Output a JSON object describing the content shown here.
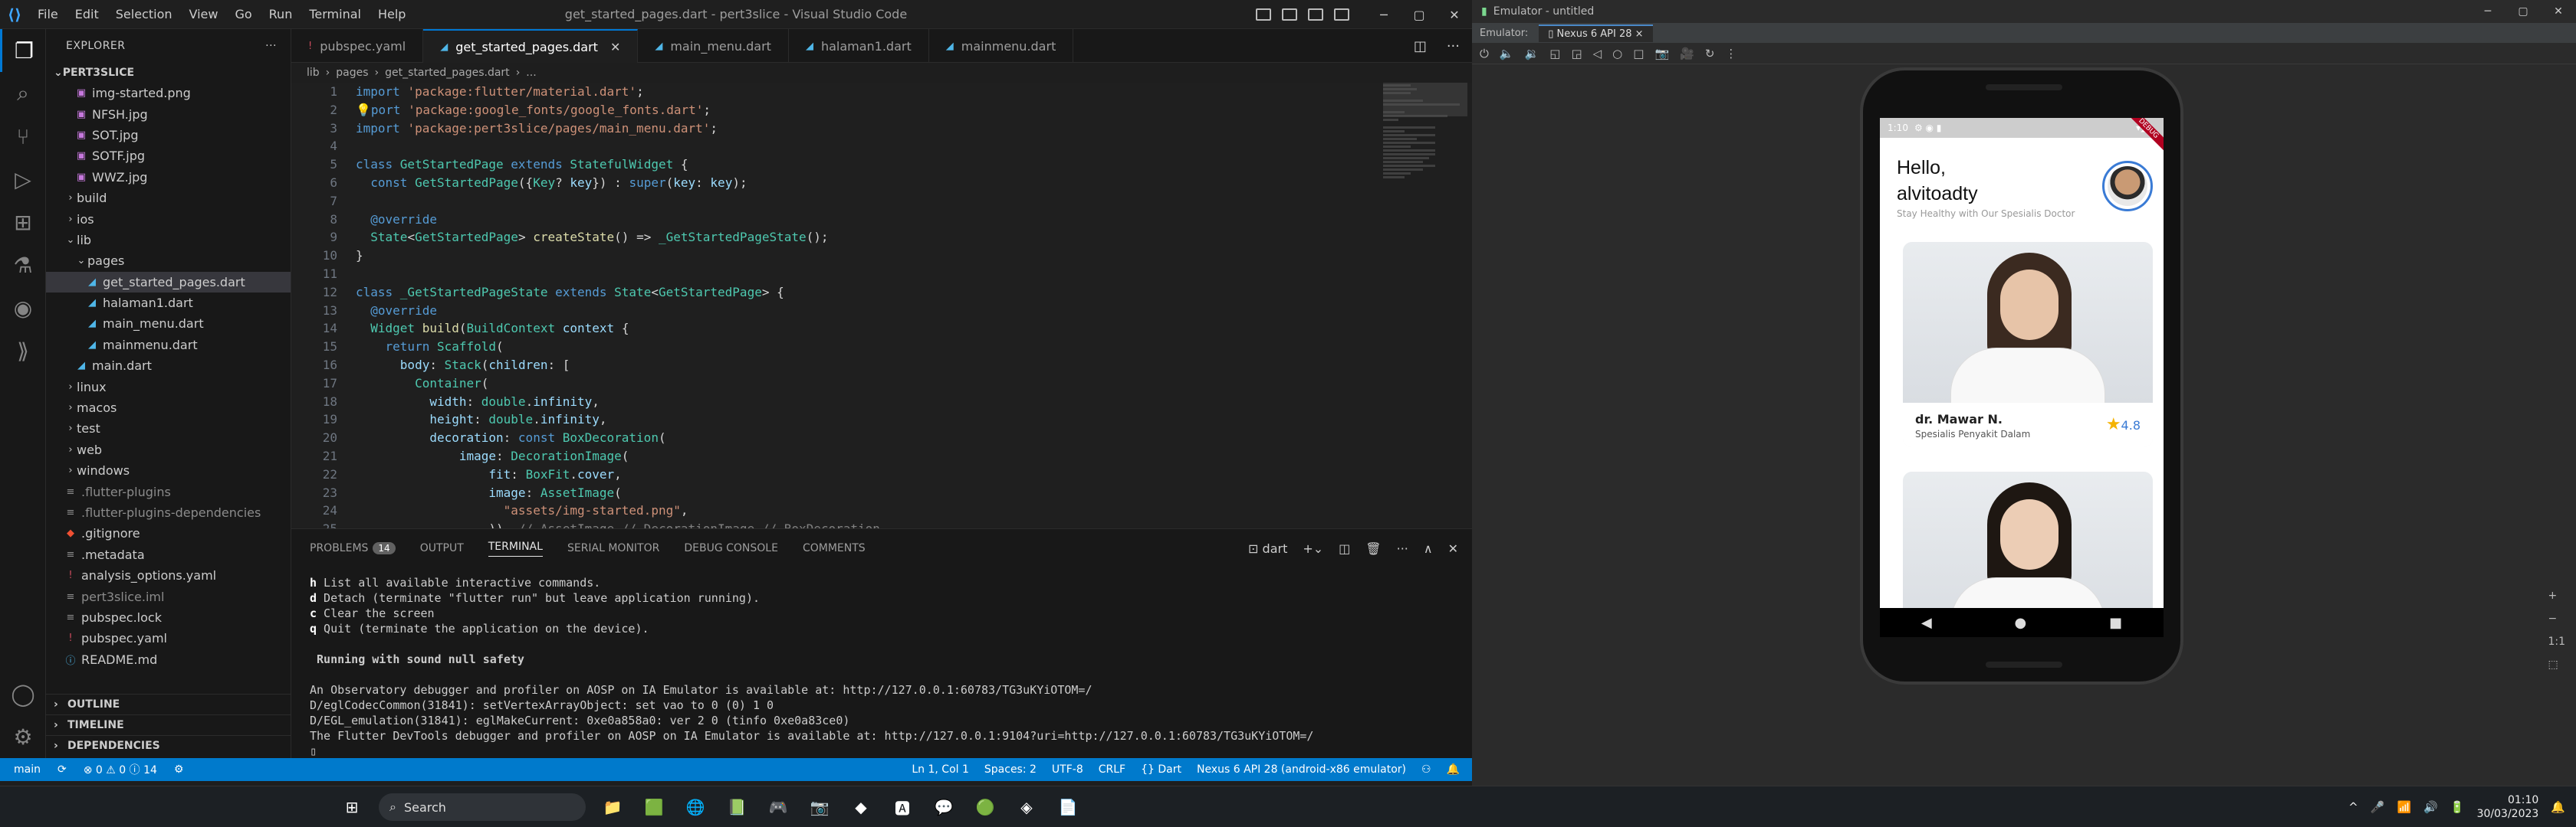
{
  "vscode": {
    "window_title": "get_started_pages.dart - pert3slice - Visual Studio Code",
    "menu": [
      "File",
      "Edit",
      "Selection",
      "View",
      "Go",
      "Run",
      "Terminal",
      "Help"
    ],
    "explorer_label": "EXPLORER",
    "explorer_more": "···",
    "project_root": "PERT3SLICE",
    "tree": [
      {
        "label": "img-started.png",
        "kind": "image",
        "indent": 2
      },
      {
        "label": "NFSH.jpg",
        "kind": "image",
        "indent": 2
      },
      {
        "label": "SOT.jpg",
        "kind": "image",
        "indent": 2
      },
      {
        "label": "SOTF.jpg",
        "kind": "image",
        "indent": 2
      },
      {
        "label": "WWZ.jpg",
        "kind": "image",
        "indent": 2
      },
      {
        "label": "build",
        "kind": "folder",
        "indent": 1
      },
      {
        "label": "ios",
        "kind": "folder",
        "indent": 1
      },
      {
        "label": "lib",
        "kind": "folder-open",
        "indent": 1
      },
      {
        "label": "pages",
        "kind": "folder-open",
        "indent": 2
      },
      {
        "label": "get_started_pages.dart",
        "kind": "dart",
        "indent": 3,
        "selected": true
      },
      {
        "label": "halaman1.dart",
        "kind": "dart",
        "indent": 3
      },
      {
        "label": "main_menu.dart",
        "kind": "dart",
        "indent": 3
      },
      {
        "label": "mainmenu.dart",
        "kind": "dart",
        "indent": 3
      },
      {
        "label": "main.dart",
        "kind": "dart",
        "indent": 2
      },
      {
        "label": "linux",
        "kind": "folder",
        "indent": 1
      },
      {
        "label": "macos",
        "kind": "folder",
        "indent": 1
      },
      {
        "label": "test",
        "kind": "folder",
        "indent": 1
      },
      {
        "label": "web",
        "kind": "folder",
        "indent": 1
      },
      {
        "label": "windows",
        "kind": "folder",
        "indent": 1
      },
      {
        "label": ".flutter-plugins",
        "kind": "dim",
        "indent": 1
      },
      {
        "label": ".flutter-plugins-dependencies",
        "kind": "dim",
        "indent": 1
      },
      {
        "label": ".gitignore",
        "kind": "git",
        "indent": 1
      },
      {
        "label": ".metadata",
        "kind": "meta",
        "indent": 1
      },
      {
        "label": "analysis_options.yaml",
        "kind": "yaml",
        "indent": 1
      },
      {
        "label": "pert3slice.iml",
        "kind": "dim",
        "indent": 1
      },
      {
        "label": "pubspec.lock",
        "kind": "meta",
        "indent": 1
      },
      {
        "label": "pubspec.yaml",
        "kind": "yaml",
        "indent": 1
      },
      {
        "label": "README.md",
        "kind": "info",
        "indent": 1
      }
    ],
    "sections": [
      "OUTLINE",
      "TIMELINE",
      "DEPENDENCIES"
    ],
    "tabs": [
      {
        "label": "pubspec.yaml",
        "active": false
      },
      {
        "label": "get_started_pages.dart",
        "active": true
      },
      {
        "label": "main_menu.dart",
        "active": false
      },
      {
        "label": "halaman1.dart",
        "active": false
      },
      {
        "label": "mainmenu.dart",
        "active": false
      }
    ],
    "breadcrumb": [
      "lib",
      "pages",
      "get_started_pages.dart",
      "..."
    ],
    "code_lines": [
      [
        [
          "k",
          "import "
        ],
        [
          "s",
          "'package:flutter/material.dart'"
        ],
        [
          "",
          "; "
        ]
      ],
      [
        [
          "c",
          "💡"
        ],
        [
          "k",
          "port "
        ],
        [
          "s",
          "'package:google_fonts/google_fonts.dart'"
        ],
        [
          "",
          ";"
        ]
      ],
      [
        [
          "k",
          "import "
        ],
        [
          "s",
          "'package:pert3slice/pages/main_menu.dart'"
        ],
        [
          "",
          ";"
        ]
      ],
      [],
      [
        [
          "k",
          "class "
        ],
        [
          "t",
          "GetStartedPage "
        ],
        [
          "k",
          "extends "
        ],
        [
          "t",
          "StatefulWidget "
        ],
        [
          "",
          "{"
        ]
      ],
      [
        [
          "",
          "  "
        ],
        [
          "k",
          "const "
        ],
        [
          "t",
          "GetStartedPage"
        ],
        [
          "",
          "({"
        ],
        [
          "t",
          "Key"
        ],
        [
          "",
          "? "
        ],
        [
          "p",
          "key"
        ],
        [
          "",
          "}) : "
        ],
        [
          "k",
          "super"
        ],
        [
          "",
          "("
        ],
        [
          "p",
          "key"
        ],
        [
          "",
          ": "
        ],
        [
          "p",
          "key"
        ],
        [
          "",
          "); "
        ]
      ],
      [],
      [
        [
          "",
          "  "
        ],
        [
          "k",
          "@override"
        ]
      ],
      [
        [
          "",
          "  "
        ],
        [
          "t",
          "State"
        ],
        [
          "",
          "<"
        ],
        [
          "t",
          "GetStartedPage"
        ],
        [
          "",
          "> "
        ],
        [
          "f",
          "createState"
        ],
        [
          "",
          "() => "
        ],
        [
          "t",
          "_GetStartedPageState"
        ],
        [
          "",
          "();"
        ]
      ],
      [
        [
          "",
          "}"
        ]
      ],
      [],
      [
        [
          "k",
          "class "
        ],
        [
          "t",
          "_GetStartedPageState "
        ],
        [
          "k",
          "extends "
        ],
        [
          "t",
          "State"
        ],
        [
          "",
          "<"
        ],
        [
          "t",
          "GetStartedPage"
        ],
        [
          "",
          "> {"
        ]
      ],
      [
        [
          "",
          "  "
        ],
        [
          "k",
          "@override"
        ]
      ],
      [
        [
          "",
          "  "
        ],
        [
          "t",
          "Widget "
        ],
        [
          "f",
          "build"
        ],
        [
          "",
          "("
        ],
        [
          "t",
          "BuildContext "
        ],
        [
          "p",
          "context"
        ],
        [
          "",
          " {"
        ]
      ],
      [
        [
          "",
          "    "
        ],
        [
          "k",
          "return "
        ],
        [
          "t",
          "Scaffold"
        ],
        [
          "",
          "("
        ]
      ],
      [
        [
          "",
          "      "
        ],
        [
          "p",
          "body"
        ],
        [
          "",
          ": "
        ],
        [
          "t",
          "Stack"
        ],
        [
          "",
          "("
        ],
        [
          "p",
          "children"
        ],
        [
          "",
          ": ["
        ]
      ],
      [
        [
          "",
          "        "
        ],
        [
          "t",
          "Container"
        ],
        [
          "",
          "("
        ]
      ],
      [
        [
          "",
          "          "
        ],
        [
          "p",
          "width"
        ],
        [
          "",
          ": "
        ],
        [
          "t",
          "double"
        ],
        [
          "",
          "."
        ],
        [
          "p",
          "infinity"
        ],
        [
          "",
          ","
        ]
      ],
      [
        [
          "",
          "          "
        ],
        [
          "p",
          "height"
        ],
        [
          "",
          ": "
        ],
        [
          "t",
          "double"
        ],
        [
          "",
          "."
        ],
        [
          "p",
          "infinity"
        ],
        [
          "",
          ","
        ]
      ],
      [
        [
          "",
          "          "
        ],
        [
          "p",
          "decoration"
        ],
        [
          "",
          ": "
        ],
        [
          "k",
          "const "
        ],
        [
          "t",
          "BoxDecoration"
        ],
        [
          "",
          "("
        ]
      ],
      [
        [
          "",
          "              "
        ],
        [
          "p",
          "image"
        ],
        [
          "",
          ": "
        ],
        [
          "t",
          "DecorationImage"
        ],
        [
          "",
          "("
        ]
      ],
      [
        [
          "",
          "                  "
        ],
        [
          "p",
          "fit"
        ],
        [
          "",
          ": "
        ],
        [
          "t",
          "BoxFit"
        ],
        [
          "",
          "."
        ],
        [
          "p",
          "cover"
        ],
        [
          "",
          ","
        ]
      ],
      [
        [
          "",
          "                  "
        ],
        [
          "p",
          "image"
        ],
        [
          "",
          ": "
        ],
        [
          "t",
          "AssetImage"
        ],
        [
          "",
          "("
        ]
      ],
      [
        [
          "",
          "                    "
        ],
        [
          "s",
          "\"assets/img-started.png\""
        ],
        [
          "",
          ","
        ]
      ],
      [
        [
          "",
          "                  )), "
        ],
        [
          "d",
          "// AssetImage // DecorationImage // BoxDecoration"
        ]
      ]
    ],
    "panel_tabs": [
      {
        "label": "PROBLEMS",
        "badge": "14"
      },
      {
        "label": "OUTPUT"
      },
      {
        "label": "TERMINAL",
        "active": true
      },
      {
        "label": "SERIAL MONITOR"
      },
      {
        "label": "DEBUG CONSOLE"
      },
      {
        "label": "COMMENTS"
      }
    ],
    "terminal_shell": "dart",
    "terminal_lines": [
      {
        "key": "h",
        "text": " List all available interactive commands."
      },
      {
        "key": "d",
        "text": " Detach (terminate \"flutter run\" but leave application running)."
      },
      {
        "key": "c",
        "text": " Clear the screen"
      },
      {
        "key": "q",
        "text": " Quit (terminate the application on the device)."
      },
      {
        "key": "",
        "text": ""
      },
      {
        "key": "",
        "text": " Running with sound null safety",
        "bold": true
      },
      {
        "key": "",
        "text": ""
      },
      {
        "key": "",
        "text": "An Observatory debugger and profiler on AOSP on IA Emulator is available at: http://127.0.0.1:60783/TG3uKYiOTOM=/"
      },
      {
        "key": "",
        "text": "D/eglCodecCommon(31841): setVertexArrayObject: set vao to 0 (0) 1 0"
      },
      {
        "key": "",
        "text": "D/EGL_emulation(31841): eglMakeCurrent: 0xe0a858a0: ver 2 0 (tinfo 0xe0a83ce0)"
      },
      {
        "key": "",
        "text": "The Flutter DevTools debugger and profiler on AOSP on IA Emulator is available at: http://127.0.0.1:9104?uri=http://127.0.0.1:60783/TG3uKYiOTOM=/"
      },
      {
        "key": "",
        "text": "▯"
      }
    ],
    "status_left": [
      "main",
      "⟳",
      "⊗ 0  ⚠ 0  ⓘ 14",
      "⚙"
    ],
    "status_right": [
      "Ln 1, Col 1",
      "Spaces: 2",
      "UTF-8",
      "CRLF",
      "{} Dart",
      "Nexus 6 API 28 (android-x86 emulator)",
      "⚇",
      "🔔"
    ]
  },
  "emulator": {
    "window_title": "Emulator - untitled",
    "tab_label": "Emulator:",
    "device_tab": "Nexus 6 API 28",
    "toolbar": [
      "⏻",
      "🔈",
      "🔉",
      "◱",
      "◲",
      "◁",
      "○",
      "□",
      "📷",
      "🎥",
      "↻",
      "⋮"
    ],
    "side_tools": [
      "+",
      "−",
      "1:1",
      "⬚"
    ],
    "phone": {
      "status_time": "1:10",
      "debug_banner": "DEBUG",
      "greeting_line1": "Hello,",
      "greeting_line2": "alvitoadty",
      "subtitle": "Stay Healthy with Our Spesialis Doctor",
      "cards": [
        {
          "name": "dr. Mawar N.",
          "specialty": "Spesialis Penyakit Dalam",
          "rating": "4.8"
        },
        {
          "name": "",
          "specialty": "",
          "rating": ""
        }
      ],
      "nav": [
        "◀",
        "●",
        "■"
      ]
    }
  },
  "taskbar": {
    "search_placeholder": "Search",
    "apps": [
      "⊞",
      "🔍",
      "📁",
      "🟩",
      "🌐",
      "📗",
      "🎮",
      "📷",
      "◆",
      "🅰",
      "💬",
      "🟢",
      "◈",
      "📄"
    ],
    "tray": [
      "^",
      "🎤",
      "📶",
      "🔊",
      "🔋"
    ],
    "time": "01:10",
    "date": "30/03/2023"
  }
}
